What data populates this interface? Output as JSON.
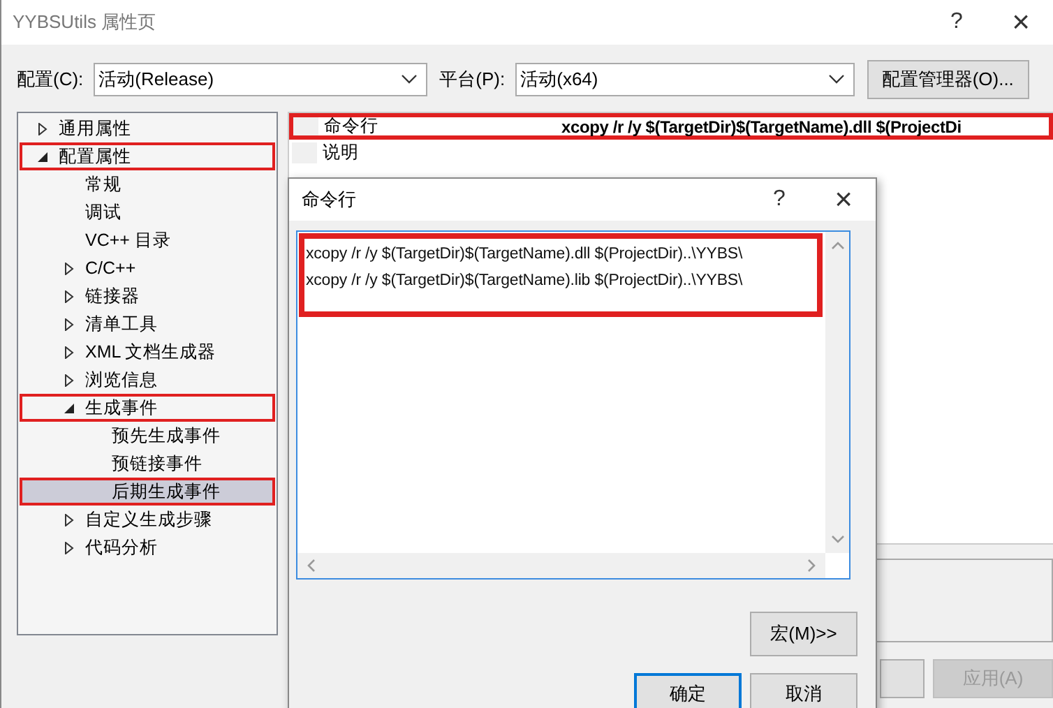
{
  "window": {
    "title": "YYBSUtils 属性页",
    "help": "?",
    "close": "×"
  },
  "toolbar": {
    "config_label": "配置(C):",
    "config_value": "活动(Release)",
    "platform_label": "平台(P):",
    "platform_value": "活动(x64)",
    "manager_button": "配置管理器(O)..."
  },
  "tree": [
    {
      "label": "通用属性",
      "expanded": false,
      "selected": false,
      "highlighted": false
    },
    {
      "label": "配置属性",
      "expanded": true,
      "selected": false,
      "highlighted": true,
      "children": [
        {
          "label": "常规",
          "selected": false,
          "highlighted": false
        },
        {
          "label": "调试",
          "selected": false,
          "highlighted": false
        },
        {
          "label": "VC++ 目录",
          "selected": false,
          "highlighted": false
        },
        {
          "label": "C/C++",
          "expanded": false,
          "selected": false,
          "highlighted": false
        },
        {
          "label": "链接器",
          "expanded": false,
          "selected": false,
          "highlighted": false
        },
        {
          "label": "清单工具",
          "expanded": false,
          "selected": false,
          "highlighted": false
        },
        {
          "label": "XML 文档生成器",
          "expanded": false,
          "selected": false,
          "highlighted": false
        },
        {
          "label": "浏览信息",
          "expanded": false,
          "selected": false,
          "highlighted": false
        },
        {
          "label": "生成事件",
          "expanded": true,
          "selected": false,
          "highlighted": true,
          "children": [
            {
              "label": "预先生成事件",
              "selected": false,
              "highlighted": false
            },
            {
              "label": "预链接事件",
              "selected": false,
              "highlighted": false
            },
            {
              "label": "后期生成事件",
              "selected": true,
              "highlighted": true
            }
          ]
        },
        {
          "label": "自定义生成步骤",
          "expanded": false,
          "selected": false,
          "highlighted": false
        },
        {
          "label": "代码分析",
          "expanded": false,
          "selected": false,
          "highlighted": false
        }
      ]
    }
  ],
  "properties": [
    {
      "name": "命令行",
      "value": "xcopy /r /y $(TargetDir)$(TargetName).dll $(ProjectDi",
      "highlighted": true
    },
    {
      "name": "说明",
      "highlighted": false
    }
  ],
  "footer_buttons": [
    {
      "label": "应用(A)",
      "disabled": true
    }
  ],
  "dialog": {
    "title": "命令行",
    "help": "?",
    "close": "×",
    "lines": [
      "xcopy /r /y $(TargetDir)$(TargetName).dll $(ProjectDir)..\\YYBS\\",
      "xcopy /r /y $(TargetDir)$(TargetName).lib $(ProjectDir)..\\YYBS\\"
    ],
    "highlighted": true,
    "macro_button": "宏(M)>>",
    "ok_button": "确定",
    "cancel_button": "取消"
  }
}
